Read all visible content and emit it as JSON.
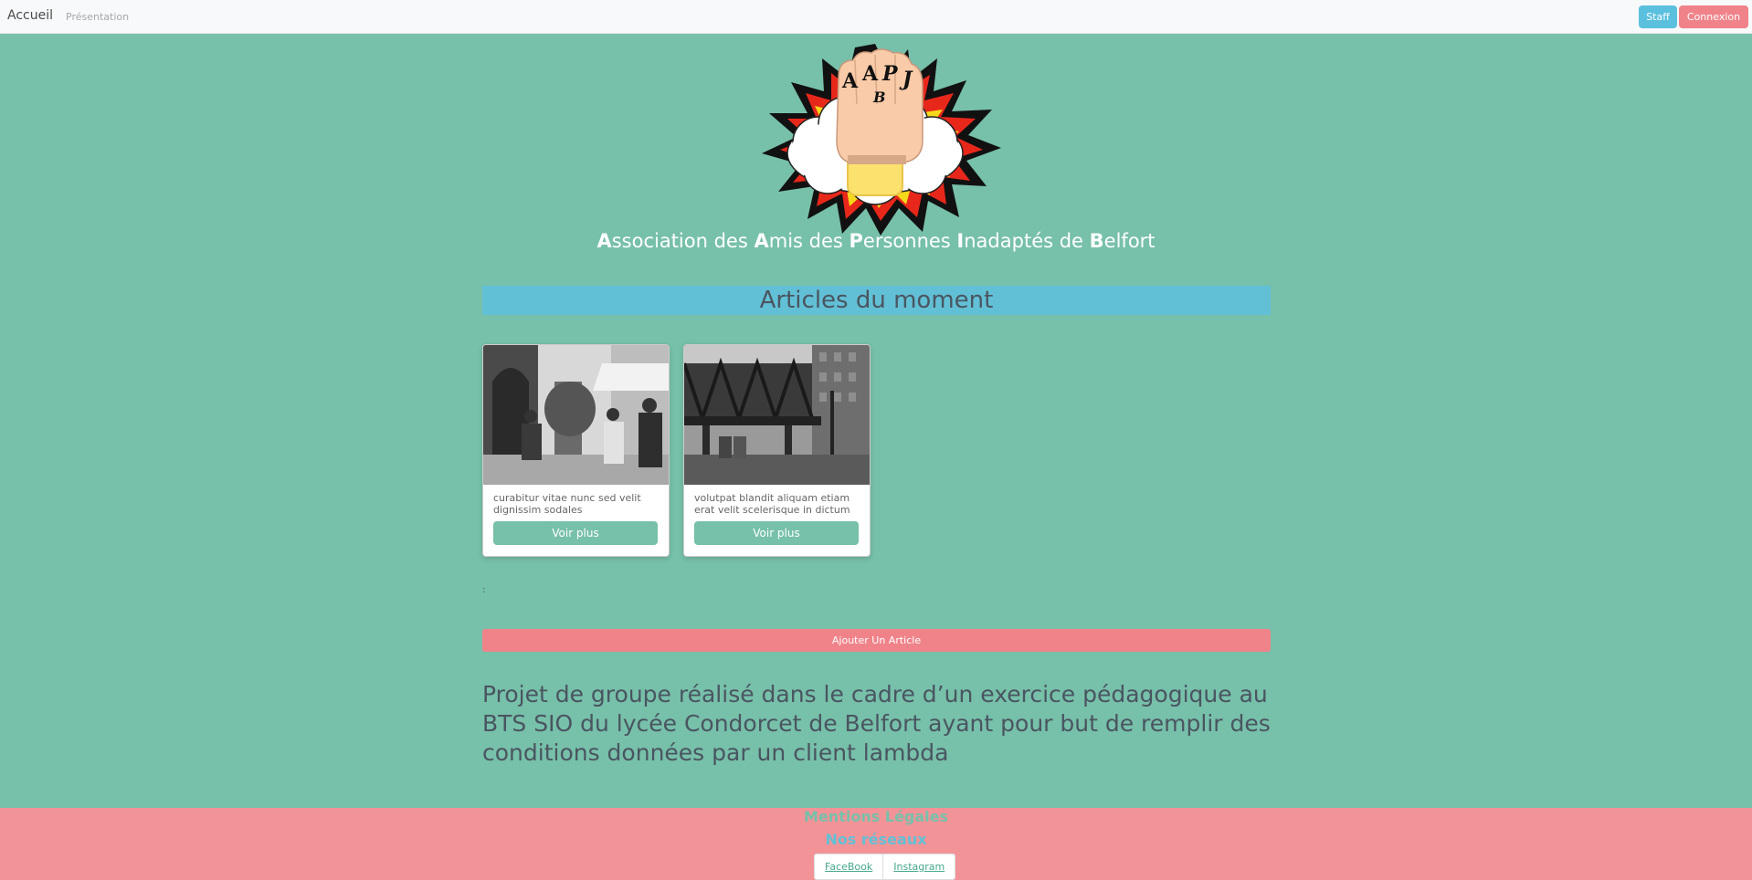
{
  "navbar": {
    "brand": "Accueil",
    "link_presentation": "Présentation",
    "staff_label": "Staff",
    "connexion_label": "Connexion"
  },
  "logo": {
    "letters": "AAPJB"
  },
  "site_title": {
    "parts": [
      {
        "bold": "A",
        "rest": "ssociation des "
      },
      {
        "bold": "A",
        "rest": "mis des "
      },
      {
        "bold": "P",
        "rest": "ersonnes "
      },
      {
        "bold": "I",
        "rest": "nadaptés de "
      },
      {
        "bold": "B",
        "rest": "elfort"
      }
    ]
  },
  "articles": {
    "heading": "Articles du moment",
    "cards": [
      {
        "text": "curabitur vitae nunc sed velit dignissim sodales",
        "button": "Voir plus",
        "image": "street-photo"
      },
      {
        "text": "volutpat blandit aliquam etiam erat velit scelerisque in dictum",
        "button": "Voir plus",
        "image": "bridge-photo"
      }
    ],
    "add_button": "Ajouter Un Article"
  },
  "mark": ":",
  "project_text": "Projet de groupe réalisé dans le cadre d’un exercice pédagogique au BTS SIO du lycée Condorcet de Belfort ayant pour but de remplir des conditions données par un client lambda",
  "footer": {
    "mentions": "Mentions Légales",
    "reseaux": "Nos réseaux",
    "links": [
      "FaceBook",
      "Instagram"
    ]
  },
  "colors": {
    "page_bg": "#77c0aa",
    "accent_blue": "#5bc0de",
    "accent_pink": "#f0838a"
  }
}
